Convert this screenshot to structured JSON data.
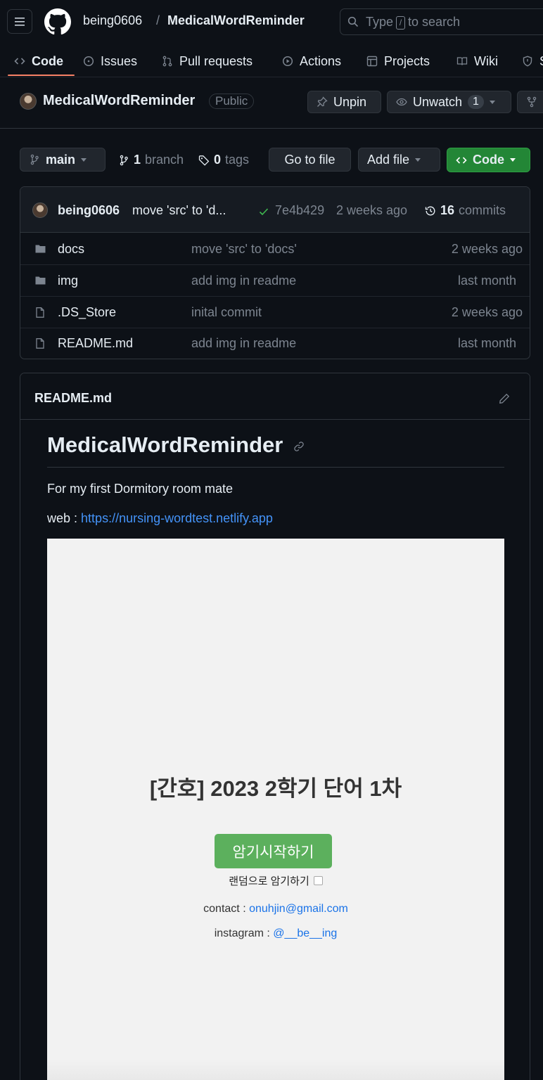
{
  "header": {
    "owner": "being0606",
    "separator": "/",
    "repo": "MedicalWordReminder",
    "search_prefix": "Type",
    "search_key": "/",
    "search_suffix": "to search"
  },
  "tabs": [
    {
      "label": "Code",
      "icon": "code-icon"
    },
    {
      "label": "Issues",
      "icon": "issue-opened-icon"
    },
    {
      "label": "Pull requests",
      "icon": "git-pull-request-icon"
    },
    {
      "label": "Actions",
      "icon": "play-icon"
    },
    {
      "label": "Projects",
      "icon": "table-icon"
    },
    {
      "label": "Wiki",
      "icon": "book-icon"
    },
    {
      "label": "S",
      "icon": "shield-icon"
    }
  ],
  "repo_bar": {
    "title": "MedicalWordReminder",
    "visibility": "Public",
    "unpin_label": "Unpin",
    "unwatch_label": "Unwatch",
    "watch_count": "1"
  },
  "branch_bar": {
    "branch": "main",
    "branch_count": "1",
    "branch_label": "branch",
    "tag_count": "0",
    "tag_label": "tags",
    "go_to_file": "Go to file",
    "add_file": "Add file",
    "code_button": "Code"
  },
  "latest_commit": {
    "author": "being0606",
    "message": "move 'src' to 'd...",
    "sha": "7e4b429",
    "time": "2 weeks ago",
    "commit_count": "16",
    "commit_label": "commits"
  },
  "files": [
    {
      "type": "folder",
      "name": "docs",
      "message": "move 'src' to 'docs'",
      "date": "2 weeks ago"
    },
    {
      "type": "folder",
      "name": "img",
      "message": "add img in readme",
      "date": "last month"
    },
    {
      "type": "file",
      "name": ".DS_Store",
      "message": "inital commit",
      "date": "2 weeks ago"
    },
    {
      "type": "file",
      "name": "README.md",
      "message": "add img in readme",
      "date": "last month"
    }
  ],
  "readme": {
    "filename": "README.md",
    "heading": "MedicalWordReminder",
    "line1": "For my first Dormitory room mate",
    "web_label": "web :",
    "web_link": "https://nursing-wordtest.netlify.app",
    "shot": {
      "title": "[간호] 2023 2학기 단어 1차",
      "start_button": "암기시작하기",
      "random_label": "랜덤으로 암기하기",
      "contact_label": "contact :",
      "contact_email": "onuhjin@gmail.com",
      "instagram_label": "instagram :",
      "instagram_handle": "@__be__ing"
    }
  },
  "colors": {
    "background": "#0d1117",
    "accent_tab": "#f78166",
    "code_button": "#238636",
    "link": "#4493f8",
    "success": "#3fb950"
  }
}
